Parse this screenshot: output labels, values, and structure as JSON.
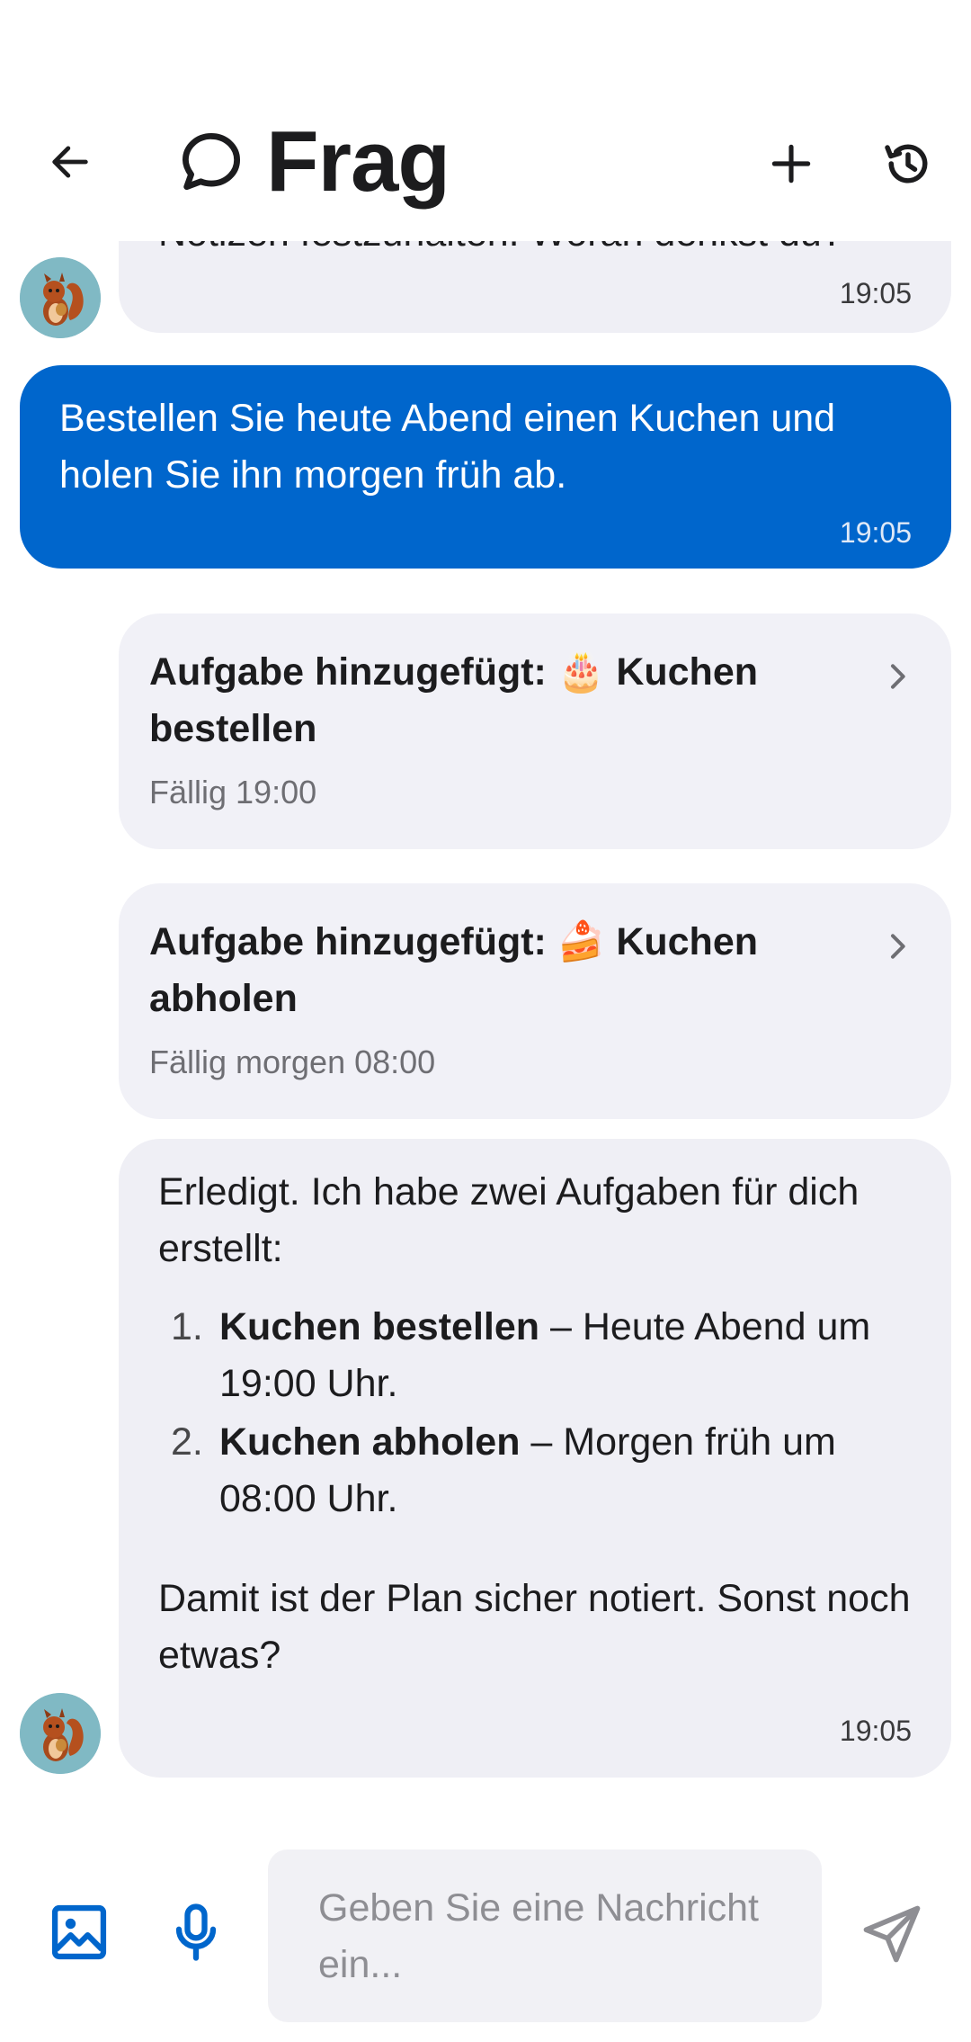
{
  "header": {
    "title": "Frag"
  },
  "messages": {
    "partial_bot": {
      "text": "Notizen festzuhalten. Woran denkst du?",
      "time": "19:05"
    },
    "user": {
      "text": "Bestellen Sie heute Abend einen Kuchen und holen Sie ihn morgen früh ab.",
      "time": "19:05"
    },
    "task1": {
      "prefix": "Aufgabe hinzugefügt:",
      "emoji": "🎂",
      "title": "Kuchen bestellen",
      "due": "Fällig 19:00"
    },
    "task2": {
      "prefix": "Aufgabe hinzugefügt:",
      "emoji": "🍰",
      "title": "Kuchen abholen",
      "due": "Fällig morgen 08:00"
    },
    "reply": {
      "intro": "Erledigt. Ich habe zwei Aufgaben für dich erstellt:",
      "items": [
        {
          "num": "1.",
          "bold": "Kuchen bestellen",
          "rest": " – Heute Abend um 19:00 Uhr."
        },
        {
          "num": "2.",
          "bold": "Kuchen abholen",
          "rest": " – Morgen früh um 08:00 Uhr."
        }
      ],
      "outro": "Damit ist der Plan sicher notiert. Sonst noch etwas?",
      "time": "19:05"
    }
  },
  "input": {
    "placeholder": "Geben Sie eine Nachricht ein..."
  },
  "icons": {
    "back": "arrow-left-icon",
    "chat": "chat-bubble-icon",
    "add": "plus-icon",
    "history": "history-icon",
    "image": "image-icon",
    "mic": "microphone-icon",
    "send": "send-icon",
    "chevron": "chevron-right-icon",
    "avatar": "squirrel-avatar"
  },
  "colors": {
    "accent": "#0066cc",
    "bot_bubble": "#efeff5",
    "card": "#f1f1f7"
  }
}
